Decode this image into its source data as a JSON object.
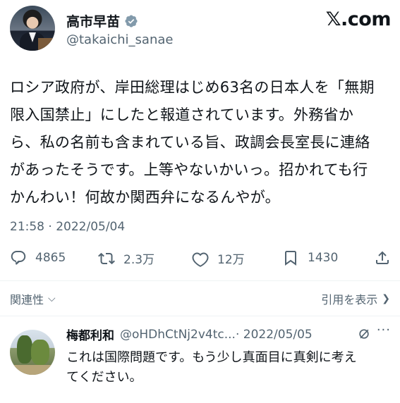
{
  "header": {
    "display_name": "高市早苗",
    "handle": "@takaichi_sanae",
    "site_logo": "𝕏.com",
    "verified_icon_color": "#829aab"
  },
  "tweet": {
    "text": "ロシア政府が、岸田総理はじめ63名の日本人を「無期\n限入国禁止」にしたと報道されています。外務省か\nら、私の名前も含まれている旨、政調会長室長に連絡\nがあったそうです。上等やないかいっ。招かれても行\nかんわい！何故か関西弁になるんやが。",
    "timestamp": "21:58 · 2022/05/04"
  },
  "actions": {
    "replies": "4865",
    "retweets": "2.3万",
    "likes": "12万",
    "bookmarks": "1430",
    "icons": [
      "reply-icon",
      "retweet-icon",
      "like-icon",
      "bookmark-icon",
      "share-icon"
    ]
  },
  "related_bar": {
    "related_label": "関連性",
    "quotes_label": "引用を表示"
  },
  "reply": {
    "name": "梅都利和",
    "handle": "@oHDhCtNj2v4tc...",
    "date": "· 2022/05/05",
    "text": "これは国際問題です。もう少し真面目に真剣に考え\nてください。"
  },
  "colors": {
    "text": "#0f1419",
    "secondary": "#536471",
    "divider": "#eff3f4"
  }
}
